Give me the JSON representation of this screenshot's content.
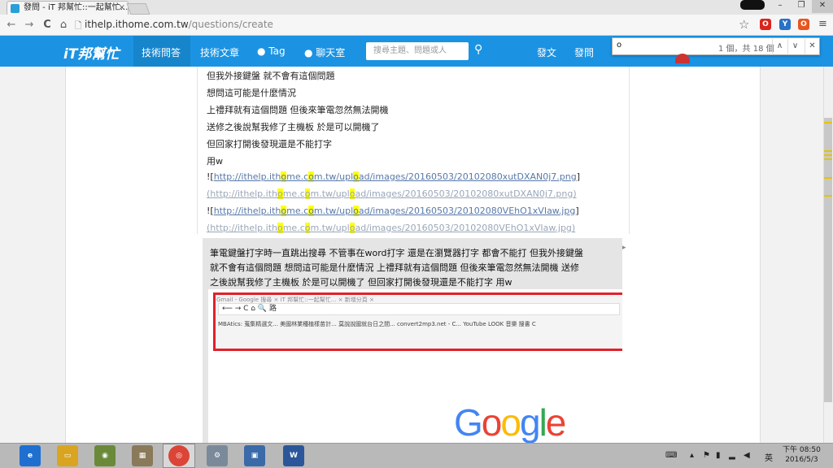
{
  "browser": {
    "tab_title": "發問 - iT 邦幫忙::一起幫忙...",
    "tab_close": "×",
    "url_host": "ithelp.ithome.com.tw",
    "url_path": "/questions/create",
    "back_icon": "←",
    "forward_icon": "→",
    "reload_icon": "C",
    "home_icon": "⌂",
    "lock_icon": "🗋",
    "star_icon": "☆",
    "menu_icon": "≡",
    "window_minimize": "–",
    "window_restore": "❐",
    "window_close": "✕"
  },
  "site": {
    "logo": "iT邦幫忙",
    "nav": [
      "技術問答",
      "技術文章",
      "Tag",
      "聊天室"
    ],
    "search_placeholder": "搜尋主題、問題或人",
    "right_nav": [
      "發文",
      "發問"
    ]
  },
  "findbar": {
    "query": "o",
    "count": "1 個，共 18 個",
    "prev": "∧",
    "next": "∨",
    "close": "✕"
  },
  "editor": {
    "lines": [
      "但我外接鍵盤 就不會有這個問題",
      "想問這可能是什麼情況",
      "上禮拜就有這個問題 但後來筆電忽然無法開機",
      "送修之後說幫我修了主機板 於是可以開機了",
      "但回家打開後發現還是不能打字",
      "用w"
    ],
    "link1_prefix": "![",
    "link1": "http://ithelp.ithome.com.tw/upload/images/20160503/20102080xutDXAN0j7.png",
    "link1_suffix": "]",
    "link1_paren": "(http://ithelp.ithome.com.tw/upload/images/20160503/20102080xutDXAN0j7.png)",
    "link2_prefix": "![",
    "link2": "http://ithelp.ithome.com.tw/upload/images/20160503/20102080VEhO1xVIaw.jpg",
    "link2_suffix": "]",
    "link2_paren": "(http://ithelp.ithome.com.tw/upload/images/20160503/20102080VEhO1xVIaw.jpg)"
  },
  "preview": {
    "lines": [
      "筆電鍵盤打字時一直跳出搜尋 不管事在word打字 還是在瀏覽器打字 都會不能打 但我外接鍵盤",
      "就不會有這個問題 想問這可能是什麼情況 上禮拜就有這個問題 但後來筆電忽然無法開機 送修",
      "之後說幫我修了主機板 於是可以開機了 但回家打開後發現還是不能打字 用w"
    ],
    "shot_tabs": "Gmail - Google 搜尋  ×  iT 邦幫忙::一起幫忙...  ×  新增分頁  ×",
    "shot_url": "⟵ → C ⌂  🔍 路",
    "shot_bookmarks": "MBAtics: 蒐集精選文...   美國林業種植樣苗計...   莫說說國就台日之間...   convert2mp3.net - C...   YouTube   LOOK   音樂   搜書   C",
    "google_letters": [
      "G",
      "o",
      "o",
      "g",
      "l",
      "e"
    ]
  },
  "taskbar": {
    "ime": "英",
    "time": "下午 08:50",
    "date": "2016/5/3"
  },
  "colors": {
    "header_blue": "#1b93e2",
    "find_highlight": "#ffff00",
    "red_frame": "#e0222a"
  }
}
